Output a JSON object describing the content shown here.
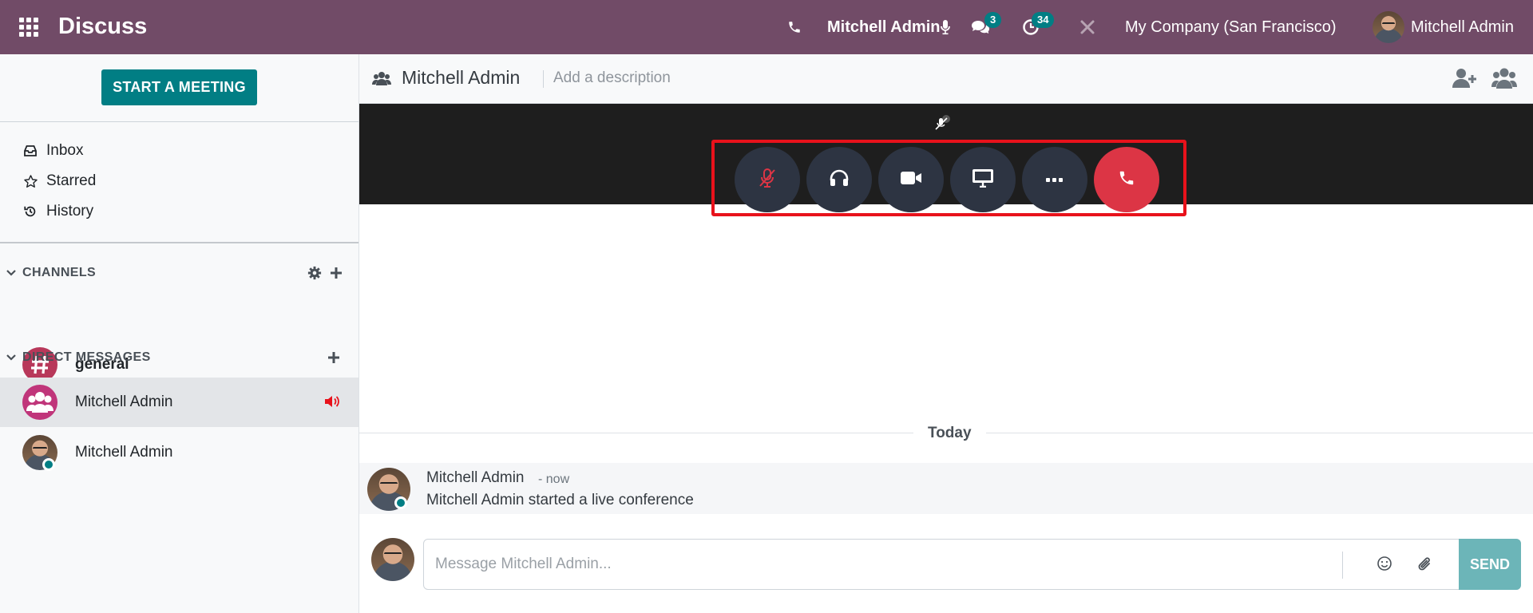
{
  "topbar": {
    "app_name": "Discuss",
    "call_user": "Mitchell Admin",
    "messages_count": "3",
    "activities_count": "34",
    "company": "My Company (San Francisco)",
    "user_name": "Mitchell Admin",
    "colors": {
      "bar": "#714b67",
      "badge": "#017e84"
    }
  },
  "sidebar": {
    "start_meeting": "START A MEETING",
    "links": [
      {
        "label": "Inbox",
        "icon": "inbox-icon"
      },
      {
        "label": "Starred",
        "icon": "star-icon"
      },
      {
        "label": "History",
        "icon": "history-icon"
      }
    ],
    "channels": {
      "title": "CHANNELS",
      "items": [
        {
          "label": "general",
          "icon": "hash-icon"
        }
      ]
    },
    "direct_messages": {
      "title": "DIRECT MESSAGES",
      "items": [
        {
          "label": "Mitchell Admin",
          "icon": "group-avatar-icon",
          "active": true,
          "in_call": true
        },
        {
          "label": "Mitchell Admin",
          "icon": "user-avatar",
          "online": true
        }
      ]
    }
  },
  "thread": {
    "name": "Mitchell Admin",
    "description_placeholder": "Add a description",
    "call_controls": [
      "mute-microphone",
      "deafen",
      "camera",
      "share-screen",
      "more",
      "hang-up"
    ],
    "date_separator": "Today",
    "messages": [
      {
        "author": "Mitchell Admin",
        "time": "- now",
        "body": "Mitchell Admin started a live conference"
      }
    ],
    "composer": {
      "placeholder": "Message Mitchell Admin...",
      "send_label": "SEND"
    }
  }
}
